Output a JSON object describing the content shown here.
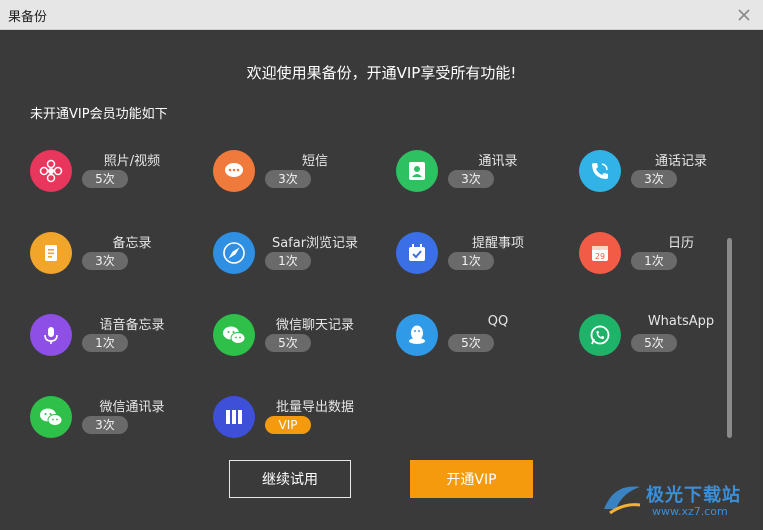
{
  "window": {
    "title": "果备份",
    "close_icon": "close-icon"
  },
  "dialog": {
    "headline": "欢迎使用果备份，开通VIP享受所有功能!",
    "subtitle": "未开通VIP会员功能如下"
  },
  "features": [
    {
      "name": "照片/视频",
      "badge": "5次",
      "icon": "flower-icon",
      "color": "#e8365d"
    },
    {
      "name": "短信",
      "badge": "3次",
      "icon": "message-icon",
      "color": "#f07a3c"
    },
    {
      "name": "通讯录",
      "badge": "3次",
      "icon": "contacts-icon",
      "color": "#2ec162"
    },
    {
      "name": "通话记录",
      "badge": "3次",
      "icon": "phone-icon",
      "color": "#31b3e8"
    },
    {
      "name": "备忘录",
      "badge": "3次",
      "icon": "notes-icon",
      "color": "#f2a52b"
    },
    {
      "name": "Safar浏览记录",
      "badge": "1次",
      "icon": "compass-icon",
      "color": "#2f8fe3"
    },
    {
      "name": "提醒事项",
      "badge": "1次",
      "icon": "reminder-icon",
      "color": "#3a6fe6"
    },
    {
      "name": "日历",
      "badge": "1次",
      "icon": "calendar-icon",
      "color": "#f25b45"
    },
    {
      "name": "语音备忘录",
      "badge": "1次",
      "icon": "microphone-icon",
      "color": "#8d4fe6"
    },
    {
      "name": "微信聊天记录",
      "badge": "5次",
      "icon": "wechat-icon",
      "color": "#2fc04a"
    },
    {
      "name": "QQ",
      "badge": "5次",
      "icon": "qq-icon",
      "color": "#2f9be8"
    },
    {
      "name": "WhatsApp",
      "badge": "5次",
      "icon": "whatsapp-icon",
      "color": "#1fb36a"
    },
    {
      "name": "微信通讯录",
      "badge": "3次",
      "icon": "wechat-contacts-icon",
      "color": "#2fc04a"
    },
    {
      "name": "批量导出数据",
      "badge": "VIP",
      "icon": "export-icon",
      "color": "#3e4fd8"
    }
  ],
  "buttons": {
    "continue_label": "继续试用",
    "vip_label": "开通VIP"
  },
  "watermark": {
    "text": "极光下载站",
    "url": "www.xz7.com"
  }
}
